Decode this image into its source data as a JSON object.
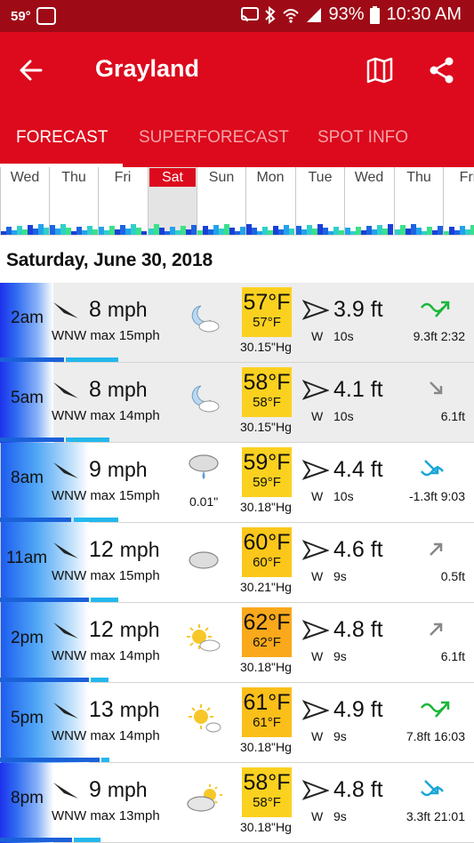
{
  "status_bar": {
    "temp": "59°",
    "battery": "93%",
    "time": "10:30 AM"
  },
  "app_bar": {
    "title": "Grayland"
  },
  "tabs": [
    {
      "label": "FORECAST",
      "active": true
    },
    {
      "label": "SUPERFORECAST",
      "active": false
    },
    {
      "label": "SPOT INFO",
      "active": false
    }
  ],
  "days": [
    {
      "label": "Wed",
      "selected": false
    },
    {
      "label": "Thu",
      "selected": false
    },
    {
      "label": "Fri",
      "selected": false
    },
    {
      "label": "Sat",
      "selected": true
    },
    {
      "label": "Sun",
      "selected": false
    },
    {
      "label": "Mon",
      "selected": false
    },
    {
      "label": "Tue",
      "selected": false
    },
    {
      "label": "Wed",
      "selected": false
    },
    {
      "label": "Thu",
      "selected": false
    },
    {
      "label": "Fri",
      "selected": false
    }
  ],
  "date_heading": "Saturday, June 30, 2018",
  "rows": [
    {
      "time": "2am",
      "wind_speed": "8",
      "wind_unit": "mph",
      "wind_sub": "WNW max 15mph",
      "weather_icon": "moon-cloud-icon",
      "precip": "",
      "temp_big": "57°F",
      "temp_small": "57°F",
      "temp_color": "#fbd11f",
      "pressure": "30.15\"Hg",
      "wave_height": "3.9 ft",
      "wave_dir": "W",
      "wave_period": "10s",
      "tide_icon": "tide-high-icon",
      "tide_text": "9.3ft 2:32"
    },
    {
      "time": "5am",
      "wind_speed": "8",
      "wind_unit": "mph",
      "wind_sub": "WNW max 14mph",
      "weather_icon": "moon-cloud-icon",
      "precip": "",
      "temp_big": "58°F",
      "temp_small": "58°F",
      "temp_color": "#fbd11f",
      "pressure": "30.15\"Hg",
      "wave_height": "4.1 ft",
      "wave_dir": "W",
      "wave_period": "10s",
      "tide_icon": "tide-falling-icon",
      "tide_text": "6.1ft"
    },
    {
      "time": "8am",
      "wind_speed": "9",
      "wind_unit": "mph",
      "wind_sub": "WNW max 15mph",
      "weather_icon": "rain-cloud-icon",
      "precip": "0.01\"",
      "temp_big": "59°F",
      "temp_small": "59°F",
      "temp_color": "#fbd11f",
      "pressure": "30.18\"Hg",
      "wave_height": "4.4 ft",
      "wave_dir": "W",
      "wave_period": "10s",
      "tide_icon": "tide-low-icon",
      "tide_text": "-1.3ft 9:03"
    },
    {
      "time": "11am",
      "wind_speed": "12",
      "wind_unit": "mph",
      "wind_sub": "WNW max 15mph",
      "weather_icon": "cloud-icon",
      "precip": "",
      "temp_big": "60°F",
      "temp_small": "60°F",
      "temp_color": "#fbc71a",
      "pressure": "30.21\"Hg",
      "wave_height": "4.6 ft",
      "wave_dir": "W",
      "wave_period": "9s",
      "tide_icon": "tide-rising-icon",
      "tide_text": "0.5ft"
    },
    {
      "time": "2pm",
      "wind_speed": "12",
      "wind_unit": "mph",
      "wind_sub": "WNW max 14mph",
      "weather_icon": "sun-cloud-icon",
      "precip": "",
      "temp_big": "62°F",
      "temp_small": "62°F",
      "temp_color": "#f9a91b",
      "pressure": "30.18\"Hg",
      "wave_height": "4.8 ft",
      "wave_dir": "W",
      "wave_period": "9s",
      "tide_icon": "tide-rising-icon",
      "tide_text": "6.1ft"
    },
    {
      "time": "5pm",
      "wind_speed": "13",
      "wind_unit": "mph",
      "wind_sub": "WNW max 14mph",
      "weather_icon": "sun-small-cloud-icon",
      "precip": "",
      "temp_big": "61°F",
      "temp_small": "61°F",
      "temp_color": "#fbbf1a",
      "pressure": "30.18\"Hg",
      "wave_height": "4.9 ft",
      "wave_dir": "W",
      "wave_period": "9s",
      "tide_icon": "tide-high-icon",
      "tide_text": "7.8ft 16:03"
    },
    {
      "time": "8pm",
      "wind_speed": "9",
      "wind_unit": "mph",
      "wind_sub": "WNW max 13mph",
      "weather_icon": "cloud-sun-icon",
      "precip": "",
      "temp_big": "58°F",
      "temp_small": "58°F",
      "temp_color": "#fbd11f",
      "pressure": "30.18\"Hg",
      "wave_height": "4.8 ft",
      "wave_dir": "W",
      "wave_period": "9s",
      "tide_icon": "tide-low-icon",
      "tide_text": "3.3ft 21:01"
    }
  ]
}
